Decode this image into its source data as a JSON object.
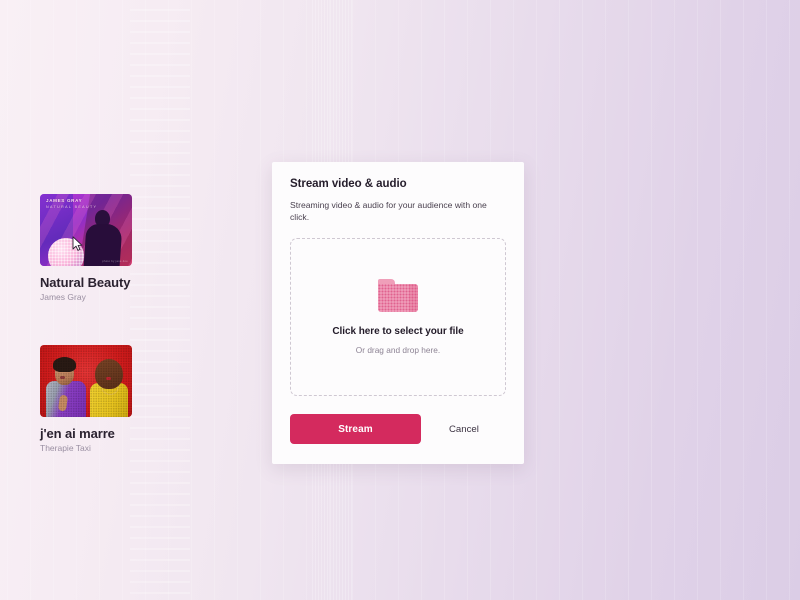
{
  "background": {
    "gradient_from": "#f9f0f5",
    "gradient_to": "#dbcde6"
  },
  "tracks": [
    {
      "title": "Natural Beauty",
      "artist": "James Gray",
      "artwork": {
        "name": "natural-beauty-artwork",
        "overlay_title": "JAMES GRAY",
        "overlay_subtitle": "NATURAL BEAUTY",
        "credit": "photo by jane doe",
        "colors": [
          "#b93bd6",
          "#8e2fc9",
          "#d8336f"
        ]
      },
      "cursor_visible": true
    },
    {
      "title": "j'en ai marre",
      "artist": "Therapie Taxi",
      "artwork": {
        "name": "jen-ai-marre-artwork",
        "colors": [
          "#e53535",
          "#b81414"
        ]
      },
      "cursor_visible": false
    }
  ],
  "dialog": {
    "title": "Stream video & audio",
    "subtitle": "Streaming video & audio for your audience with one click.",
    "dropzone": {
      "icon": "folder-icon",
      "primary_text": "Click here to select your file",
      "secondary_text": "Or drag and drop here."
    },
    "buttons": {
      "primary_label": "Stream",
      "primary_color": "#d42a5e",
      "secondary_label": "Cancel"
    }
  }
}
